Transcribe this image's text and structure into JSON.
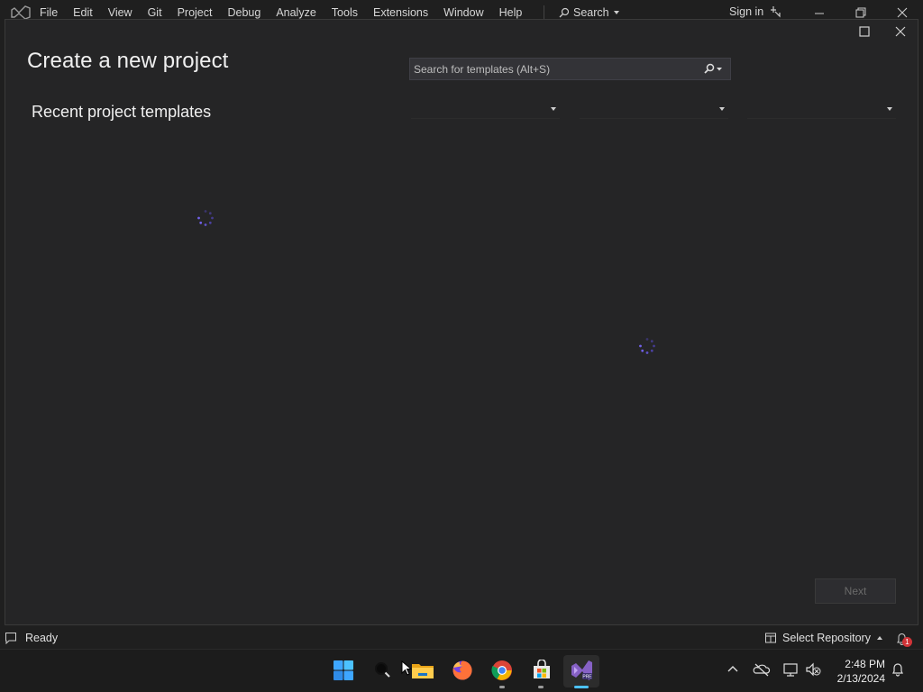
{
  "menu": {
    "items": [
      "File",
      "Edit",
      "View",
      "Git",
      "Project",
      "Debug",
      "Analyze",
      "Tools",
      "Extensions",
      "Window",
      "Help"
    ],
    "search_label": "Search",
    "signin_label": "Sign in"
  },
  "dialog": {
    "title": "Create a new project",
    "recent_heading": "Recent project templates",
    "search_placeholder": "Search for templates (Alt+S)",
    "next_label": "Next",
    "filters": [
      "",
      "",
      ""
    ]
  },
  "status": {
    "text": "Ready",
    "repo_label": "Select Repository",
    "notification_count": "1"
  },
  "taskbar": {
    "time": "2:48 PM",
    "date": "2/13/2024",
    "apps": [
      "start-icon",
      "search-icon",
      "file-explorer-icon",
      "firefox-icon",
      "chrome-icon",
      "microsoft-store-icon",
      "visual-studio-preview-icon"
    ]
  },
  "colors": {
    "accent": "#7160e8",
    "background": "#1f1f1f",
    "dialog": "#252526",
    "vs_purple": "#8661c5"
  }
}
